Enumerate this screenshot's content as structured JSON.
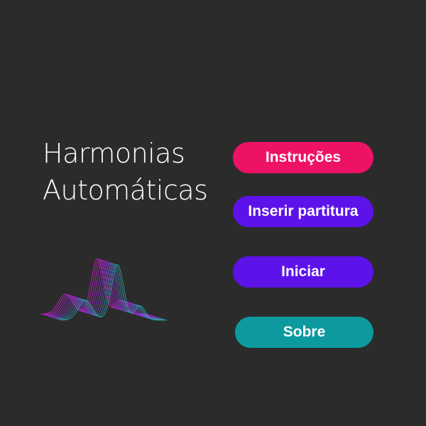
{
  "app": {
    "title_line1": "Harmonias",
    "title_line2": "Automáticas"
  },
  "menu": {
    "buttons": [
      {
        "label": "Instruções",
        "color": "#ee1266"
      },
      {
        "label": "Inserir partitura",
        "color": "#5d12ea"
      },
      {
        "label": "Iniciar",
        "color": "#5d12ea"
      },
      {
        "label": "Sobre",
        "color": "#0c9a9e"
      }
    ]
  },
  "logo": {
    "icon": "sound-wave-logo",
    "colors": [
      "#d21ec8",
      "#8a2fd6",
      "#1fb5a8"
    ]
  }
}
